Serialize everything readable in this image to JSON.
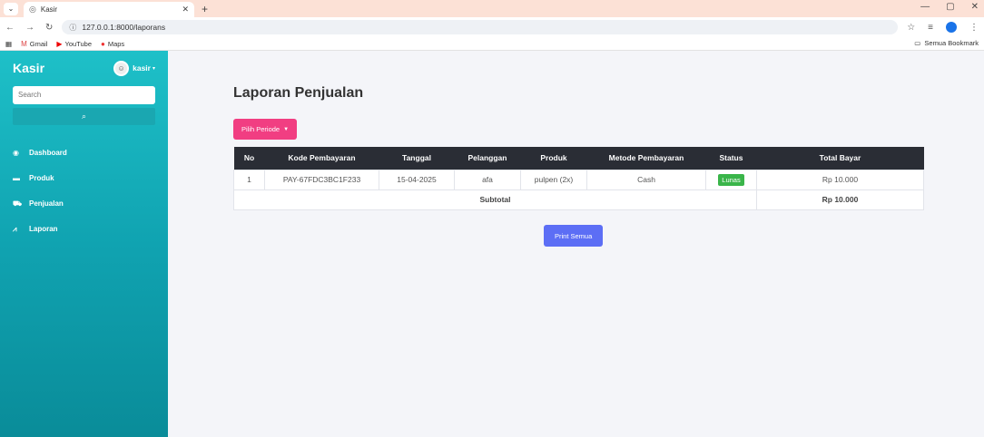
{
  "browser": {
    "tab_title": "Kasir",
    "url": "127.0.0.1:8000/laporans",
    "bookmarks": [
      "Gmail",
      "YouTube",
      "Maps"
    ],
    "bookmark_folder": "Semua Bookmark"
  },
  "sidebar": {
    "brand": "Kasir",
    "user": "kasir",
    "search_placeholder": "Search",
    "items": [
      {
        "label": "Dashboard",
        "icon": "palette-icon"
      },
      {
        "label": "Produk",
        "icon": "box-icon"
      },
      {
        "label": "Penjualan",
        "icon": "cart-icon"
      },
      {
        "label": "Laporan",
        "icon": "chart-icon"
      }
    ]
  },
  "main": {
    "title": "Laporan Penjualan",
    "periode_button": "Pilih Periode",
    "print_button": "Print Semua",
    "table": {
      "headers": [
        "No",
        "Kode Pembayaran",
        "Tanggal",
        "Pelanggan",
        "Produk",
        "Metode Pembayaran",
        "Status",
        "Total Bayar"
      ],
      "rows": [
        {
          "no": "1",
          "kode": "PAY-67FDC3BC1F233",
          "tanggal": "15-04-2025",
          "pelanggan": "afa",
          "produk": "pulpen (2x)",
          "metode": "Cash",
          "status": "Lunas",
          "total": "Rp 10.000"
        }
      ],
      "subtotal_label": "Subtotal",
      "subtotal_value": "Rp 10.000"
    }
  }
}
